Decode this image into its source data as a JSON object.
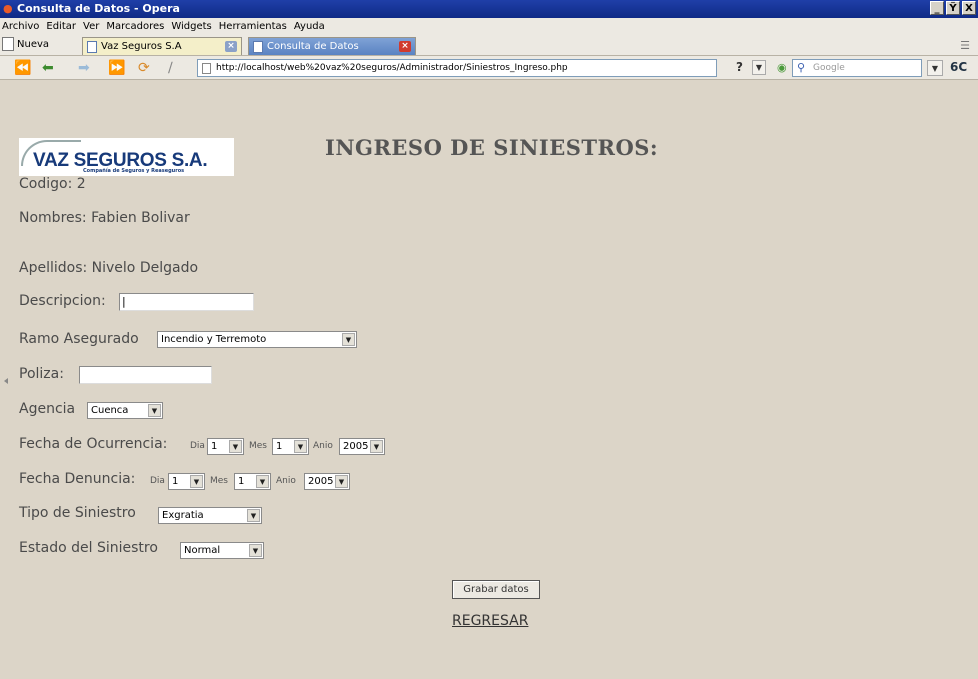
{
  "window": {
    "title": "Consulta de Datos - Opera",
    "controls": [
      "_",
      "Ÿ",
      "X"
    ]
  },
  "menu": [
    "Archivo",
    "Editar",
    "Ver",
    "Marcadores",
    "Widgets",
    "Herramientas",
    "Ayuda"
  ],
  "tabs": {
    "new_label": "Nueva",
    "items": [
      {
        "label": "Vaz Seguros S.A"
      },
      {
        "label": "Consulta de Datos"
      }
    ]
  },
  "nav": {
    "url": "http://localhost/web%20vaz%20seguros/Administrador/Siniestros_Ingreso.php",
    "search_placeholder": "Google",
    "help": "?"
  },
  "logo": {
    "brand": "VAZ SEGUROS S.A.",
    "tagline": "Compañía de Seguros y Reaseguros"
  },
  "page": {
    "heading": "INGRESO DE SINIESTROS:",
    "codigo": "Codigo: 2",
    "nombres": "Nombres: Fabien Bolivar",
    "apellidos": "Apellidos: Nivelo Delgado"
  },
  "form": {
    "descripcion_label": "Descripcion:",
    "descripcion_value": "|",
    "ramo_label": "Ramo Asegurado",
    "ramo_value": "Incendio y Terremoto",
    "poliza_label": "Poliza:",
    "poliza_value": "",
    "agencia_label": "Agencia",
    "agencia_value": "Cuenca",
    "fecha_ocurrencia_label": "Fecha de Ocurrencia:",
    "fecha_denuncia_label": "Fecha Denuncia:",
    "dia_label": "Dia",
    "mes_label": "Mes",
    "anio_label": "Anio",
    "ocurrencia": {
      "dia": "1",
      "mes": "1",
      "anio": "2005"
    },
    "denuncia": {
      "dia": "1",
      "mes": "1",
      "anio": "2005"
    },
    "tipo_label": "Tipo de Siniestro",
    "tipo_value": "Exgratia",
    "estado_label": "Estado del Siniestro",
    "estado_value": "Normal",
    "submit_label": "Grabar datos",
    "back_label": "REGRESAR"
  }
}
